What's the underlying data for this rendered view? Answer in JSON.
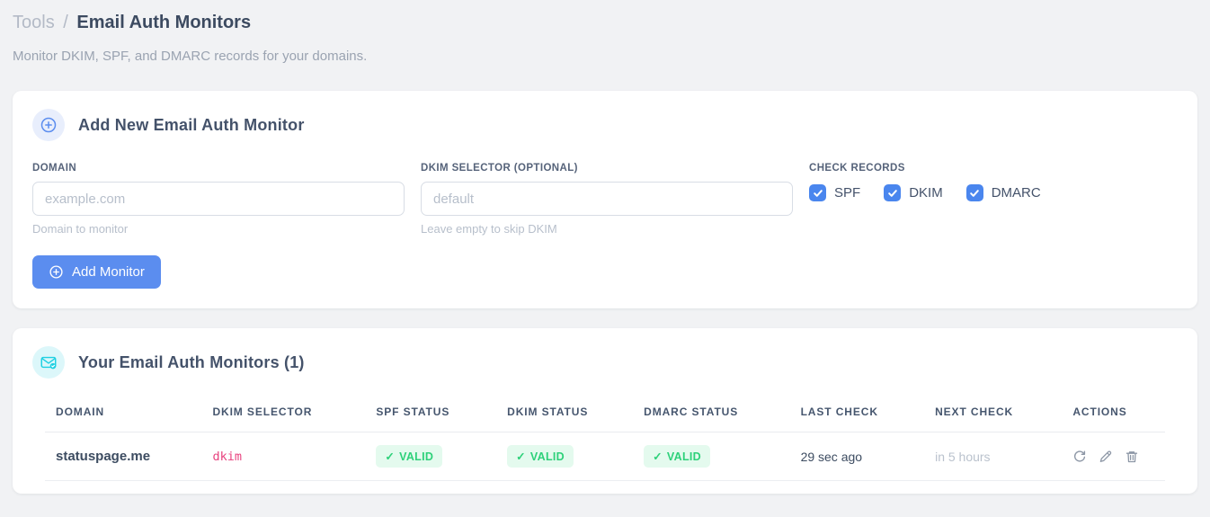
{
  "breadcrumb": {
    "section": "Tools",
    "separator": "/",
    "page": "Email Auth Monitors"
  },
  "subtitle": "Monitor DKIM, SPF, and DMARC records for your domains.",
  "add_card": {
    "title": "Add New Email Auth Monitor",
    "fields": {
      "domain": {
        "label": "DOMAIN",
        "value": "",
        "placeholder": "example.com",
        "hint": "Domain to monitor"
      },
      "dkim_selector": {
        "label": "DKIM SELECTOR (OPTIONAL)",
        "value": "",
        "placeholder": "default",
        "hint": "Leave empty to skip DKIM"
      }
    },
    "check_records": {
      "label": "CHECK RECORDS",
      "options": [
        {
          "label": "SPF",
          "checked": true
        },
        {
          "label": "DKIM",
          "checked": true
        },
        {
          "label": "DMARC",
          "checked": true
        }
      ]
    },
    "submit_label": "Add Monitor"
  },
  "monitors_card": {
    "title": "Your Email Auth Monitors (1)",
    "count": 1,
    "table": {
      "columns": [
        "DOMAIN",
        "DKIM SELECTOR",
        "SPF STATUS",
        "DKIM STATUS",
        "DMARC STATUS",
        "LAST CHECK",
        "NEXT CHECK",
        "ACTIONS"
      ],
      "rows": [
        {
          "domain": "statuspage.me",
          "dkim_selector": "dkim",
          "spf": {
            "glyph": "✓",
            "label": "VALID"
          },
          "dkim": {
            "glyph": "✓",
            "label": "VALID"
          },
          "dmarc": {
            "glyph": "✓",
            "label": "VALID"
          },
          "last_check": "29 sec ago",
          "next_check": "in 5 hours",
          "actions": [
            "refresh",
            "edit",
            "delete"
          ]
        }
      ]
    }
  },
  "icons": {
    "add_section": "circle-plus-icon",
    "monitors_section": "envelope-check-icon",
    "submit_button": "circle-plus-icon",
    "row_actions": [
      "refresh-icon",
      "pencil-icon",
      "trash-icon"
    ]
  },
  "colors": {
    "accent_blue": "#5b8def",
    "checkbox_blue": "#4a86ee",
    "valid_green": "#2ed17a",
    "valid_green_bg": "#e4faee",
    "code_pink": "#e8437f",
    "section_cyan": "#1ed0e2",
    "page_background": "#f1f2f4"
  }
}
